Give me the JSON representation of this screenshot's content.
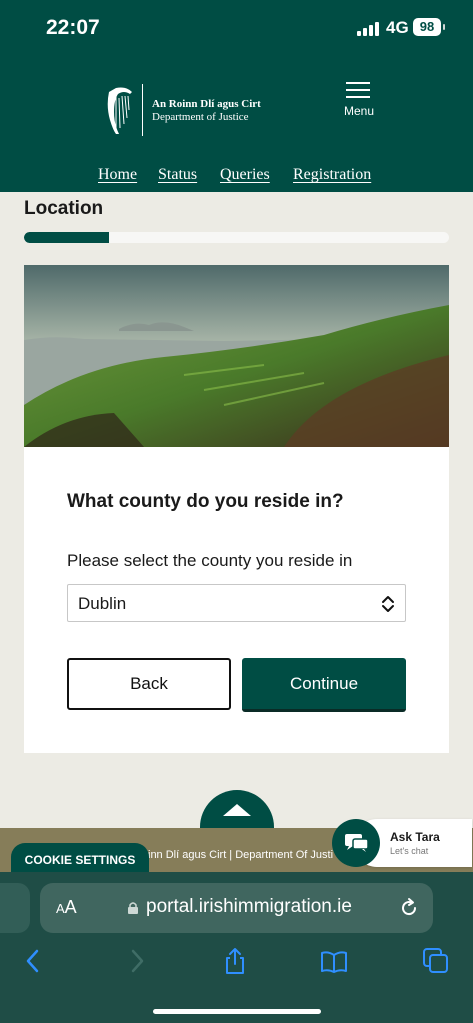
{
  "status_bar": {
    "time": "22:07",
    "network": "4G",
    "battery": "98"
  },
  "header": {
    "department_irish": "An Roinn Dlí agus Cirt",
    "department_english": "Department of Justice",
    "menu_label": "Menu",
    "nav": [
      {
        "label": "Home"
      },
      {
        "label": "Status"
      },
      {
        "label": "Queries"
      },
      {
        "label": "Registration"
      }
    ]
  },
  "page": {
    "heading": "Location",
    "progress": 0.2
  },
  "form": {
    "question": "What county do you reside in?",
    "instruction": "Please select the county you reside in",
    "selected_county": "Dublin",
    "back_label": "Back",
    "continue_label": "Continue"
  },
  "footer": {
    "text": "inn Dlí agus Cirt | Department Of Justi",
    "cookie_label": "COOKIE SETTINGS",
    "chat_title": "Ask Tara",
    "chat_subtitle": "Let's chat"
  },
  "browser": {
    "text_size": "AA",
    "url": "portal.irishimmigration.ie"
  },
  "colors": {
    "primary": "#004d44",
    "footer": "#867d59",
    "background": "#ecebe4",
    "browser": "#1f4d46"
  }
}
